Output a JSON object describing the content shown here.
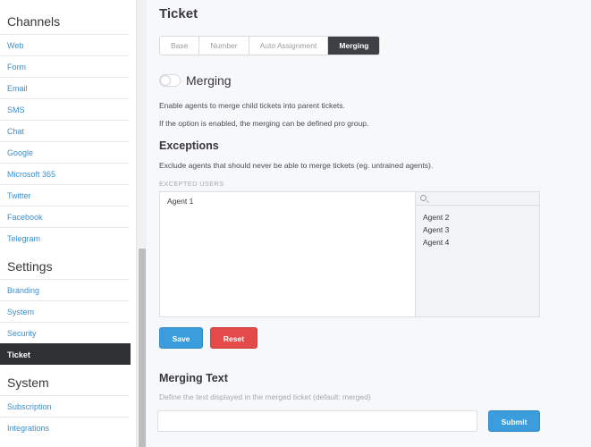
{
  "sidebar": {
    "channels": {
      "title": "Channels",
      "items": [
        "Web",
        "Form",
        "Email",
        "SMS",
        "Chat",
        "Google",
        "Microsoft 365",
        "Twitter",
        "Facebook",
        "Telegram"
      ]
    },
    "settings": {
      "title": "Settings",
      "items": [
        "Branding",
        "System",
        "Security",
        "Ticket"
      ],
      "active": "Ticket"
    },
    "system": {
      "title": "System",
      "items": [
        "Subscription",
        "Integrations"
      ]
    }
  },
  "main": {
    "title": "Ticket",
    "tabs": [
      "Base",
      "Number",
      "Auto Assignment",
      "Merging"
    ],
    "active_tab": "Merging",
    "merging": {
      "label": "Merging",
      "enabled": false,
      "desc1": "Enable agents to merge child tickets into parent tickets.",
      "desc2": "If the option is enabled, the merging can be defined pro group."
    },
    "exceptions": {
      "title": "Exceptions",
      "desc": "Exclude agents that should never be able to merge tickets (eg. untrained agents).",
      "field_label": "EXCEPTED USERS",
      "selected": [
        "Agent 1"
      ],
      "available": [
        "Agent 2",
        "Agent 3",
        "Agent 4"
      ],
      "save_label": "Save",
      "reset_label": "Reset"
    },
    "merging_text": {
      "title": "Merging Text",
      "desc": "Define the text displayed in the merged ticket (default: merged)",
      "value": "",
      "submit_label": "Submit"
    }
  },
  "colors": {
    "accent": "#3c9ddd",
    "danger": "#e54a4a",
    "active_nav": "#2f3135",
    "link": "#3b8fcf"
  }
}
